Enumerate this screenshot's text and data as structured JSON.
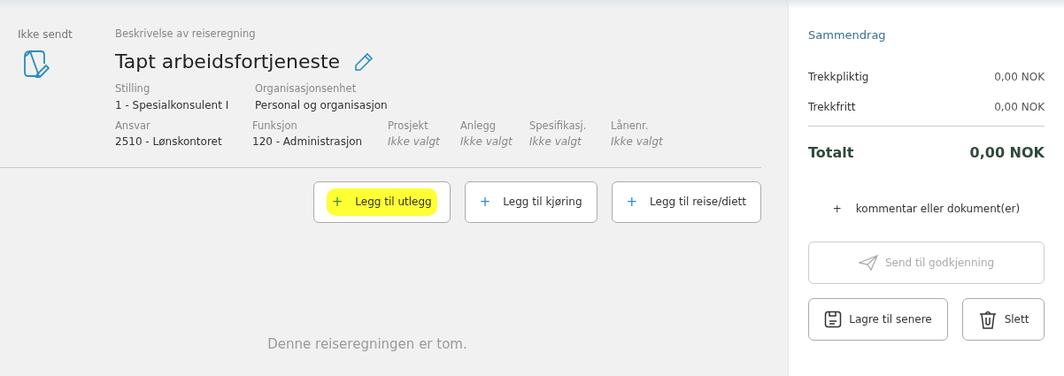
{
  "status": {
    "label": "Ikke sendt"
  },
  "description": {
    "label": "Beskrivelse av reiseregning",
    "title": "Tapt arbeidsfortjeneste"
  },
  "field_rows": [
    [
      {
        "label": "Stilling",
        "value": "1 - Spesialkonsulent I",
        "empty": false
      },
      {
        "label": "Organisasjonsenhet",
        "value": "Personal og organisasjon",
        "empty": false
      }
    ],
    [
      {
        "label": "Ansvar",
        "value": "2510 - Lønskontoret",
        "empty": false
      },
      {
        "label": "Funksjon",
        "value": "120 - Administrasjon",
        "empty": false
      },
      {
        "label": "Prosjekt",
        "value": "Ikke valgt",
        "empty": true
      },
      {
        "label": "Anlegg",
        "value": "Ikke valgt",
        "empty": true
      },
      {
        "label": "Spesifikasj.",
        "value": "Ikke valgt",
        "empty": true
      },
      {
        "label": "Lånenr.",
        "value": "Ikke valgt",
        "empty": true
      }
    ]
  ],
  "add_buttons": [
    {
      "icon": "+",
      "label": "Legg til utlegg",
      "highlighted": true
    },
    {
      "icon": "+",
      "label": "Legg til kjøring",
      "highlighted": false
    },
    {
      "icon": "+",
      "label": "Legg til reise/diett",
      "highlighted": false
    }
  ],
  "empty_message": "Denne reiseregningen er tom.",
  "summary": {
    "title": "Sammendrag",
    "rows": [
      {
        "label": "Trekkpliktig",
        "value": "0,00 NOK"
      },
      {
        "label": "Trekkfritt",
        "value": "0,00 NOK"
      }
    ],
    "total": {
      "label": "Totalt",
      "value": "0,00 NOK"
    },
    "add_link": {
      "icon": "+",
      "label": "kommentar eller dokument(er)"
    },
    "send_button": {
      "label": "Send til godkjenning",
      "disabled": true
    },
    "save_button": {
      "label": "Lagre til senere"
    },
    "delete_button": {
      "label": "Slett"
    }
  }
}
